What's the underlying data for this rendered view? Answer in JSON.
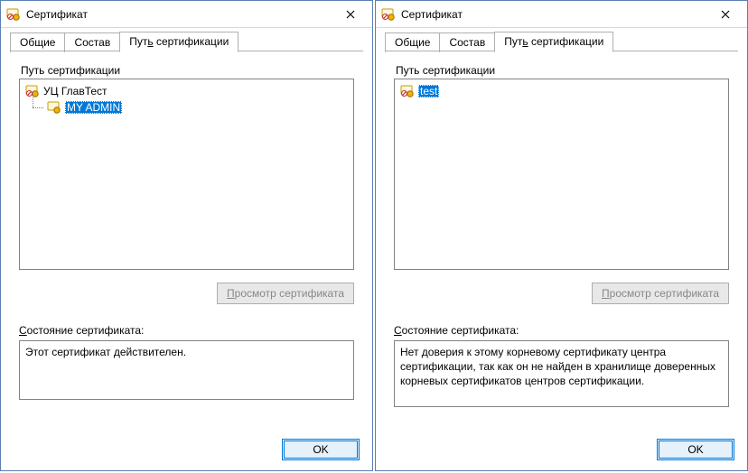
{
  "dialogs": [
    {
      "title": "Сертификат",
      "tabs": {
        "general": "Общие",
        "details": "Состав",
        "path_prefix": "Пут",
        "path_u": "ь",
        "path_suffix": " сертификации"
      },
      "group_label": "Путь сертификации",
      "tree": {
        "root": {
          "label": "УЦ ГлавТест",
          "icon": "cert-root"
        },
        "child": {
          "label": "MY ADMIN",
          "icon": "cert-ok",
          "selected": true
        }
      },
      "view_btn_prefix": "",
      "view_btn_u": "П",
      "view_btn_suffix": "росмотр сертификата",
      "view_btn_disabled": true,
      "status_label_prefix": "",
      "status_label_u": "С",
      "status_label_suffix": "остояние сертификата:",
      "status_text": "Этот сертификат действителен.",
      "status_class": "h1",
      "ok_label": "OK"
    },
    {
      "title": "Сертификат",
      "tabs": {
        "general": "Общие",
        "details": "Состав",
        "path_prefix": "Пут",
        "path_u": "ь",
        "path_suffix": " сертификации"
      },
      "group_label": "Путь сертификации",
      "tree": {
        "root": {
          "label": "test",
          "icon": "cert-bad",
          "selected": true
        },
        "child": null
      },
      "view_btn_prefix": "",
      "view_btn_u": "П",
      "view_btn_suffix": "росмотр сертификата",
      "view_btn_disabled": true,
      "status_label_prefix": "",
      "status_label_u": "С",
      "status_label_suffix": "остояние сертификата:",
      "status_text": "Нет доверия к этому корневому сертификату центра сертификации, так как он не найден в хранилище доверенных корневых сертификатов центров сертификации.",
      "status_class": "h2",
      "ok_label": "OK"
    }
  ]
}
